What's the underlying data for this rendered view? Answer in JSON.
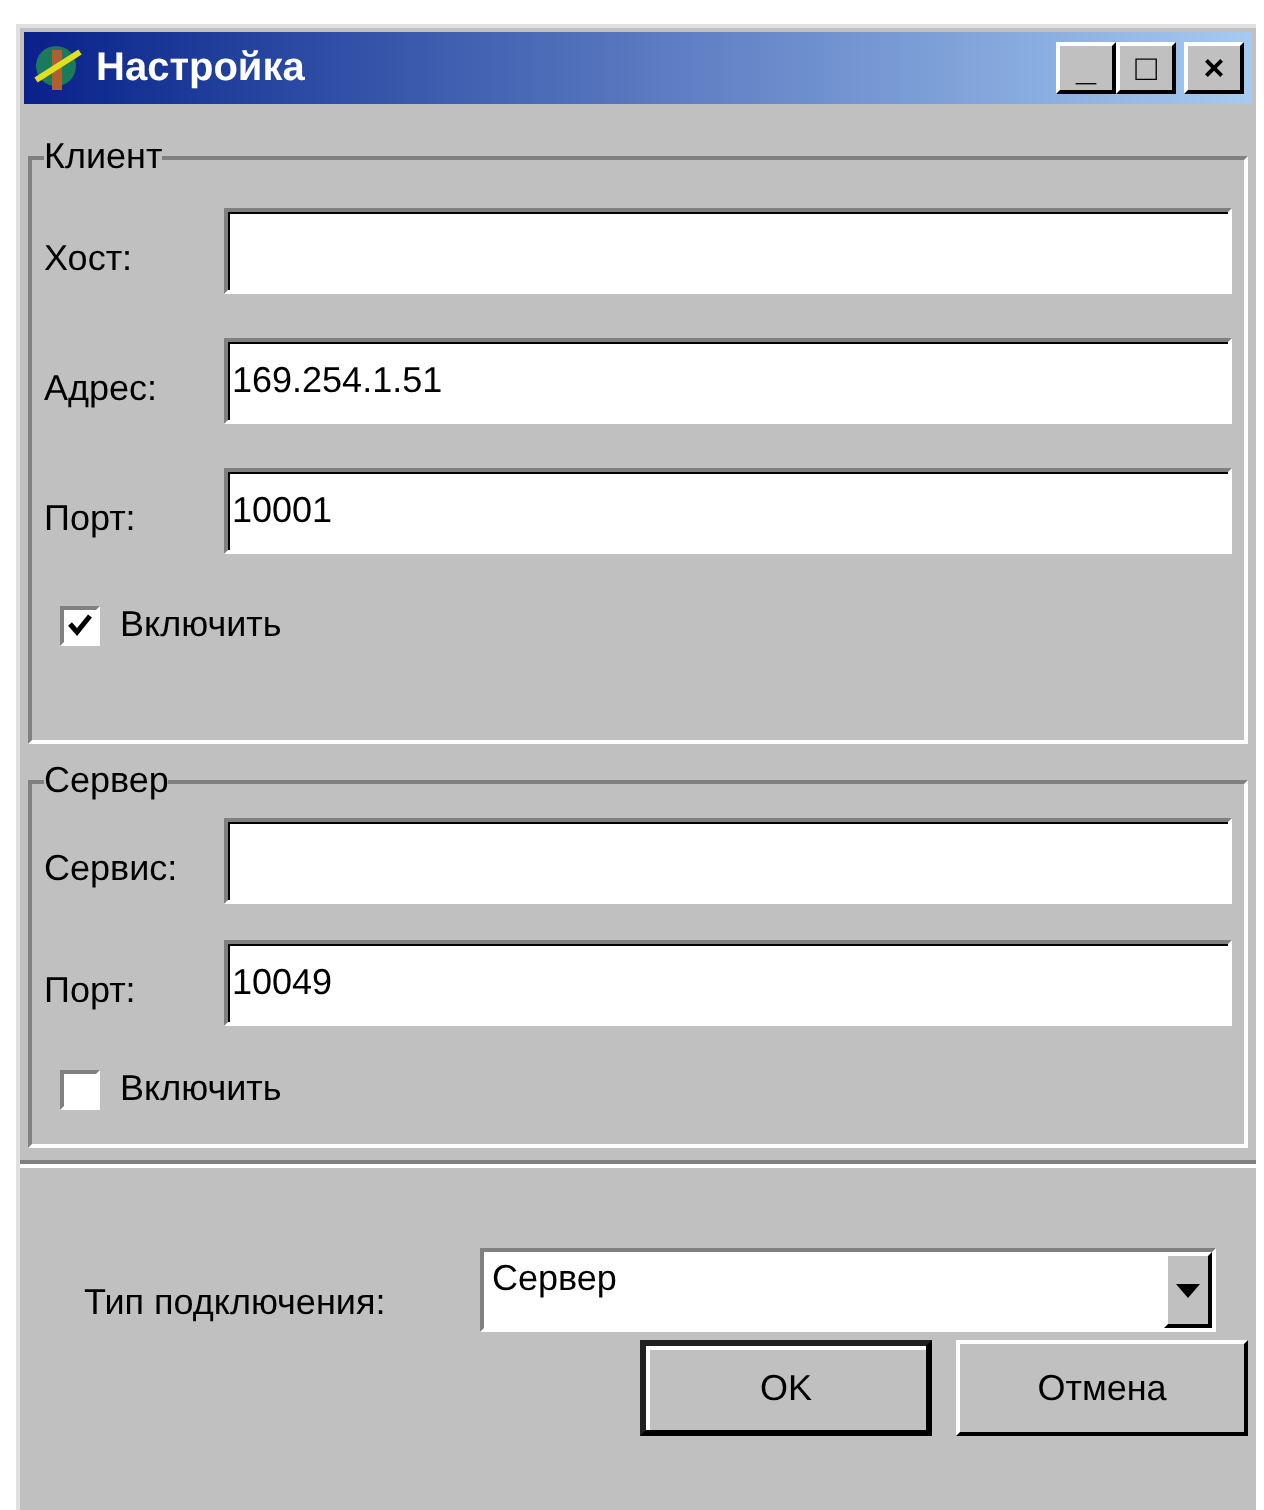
{
  "window": {
    "title": "Настройка",
    "controls": [
      "_",
      "□",
      "×"
    ]
  },
  "groups": [
    {
      "title": "Клиент",
      "fields": [
        {
          "label": "Хост:"
        },
        {
          "label": "Адрес:",
          "value": "169.254.1.51"
        },
        {
          "label": "Порт:",
          "value": "10001"
        }
      ],
      "checkbox": {
        "label": "Включить",
        "checked": true
      }
    },
    {
      "title": "Сервер",
      "fields": [
        {
          "label": "Сервис:"
        },
        {
          "label": "Порт:",
          "value": "10049"
        }
      ],
      "checkbox": {
        "label": "Включить",
        "checked": false
      }
    }
  ],
  "connection_type": {
    "label": "Тип подключения:",
    "value": "Сервер"
  },
  "buttons": [
    {
      "label": "OK",
      "default": true
    },
    {
      "label": "Отмена",
      "default": false
    }
  ]
}
